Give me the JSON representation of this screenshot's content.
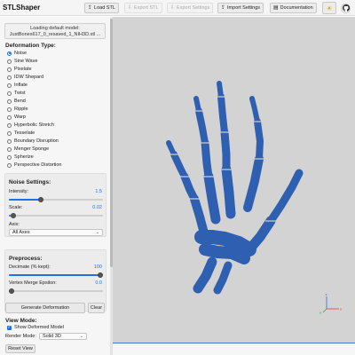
{
  "app": {
    "title": "STLShaper"
  },
  "toolbar": {
    "load_stl": "Load STL",
    "export_stl": "Export STL",
    "export_settings": "Export Settings",
    "import_settings": "Import Settings",
    "documentation": "Documentation",
    "theme_icon": "sun-icon",
    "github_icon": "github-icon"
  },
  "model": {
    "line1": "Loading default model:",
    "line2": "JustBones617_0_resaved_1_NIH3D.stl ..."
  },
  "deformation": {
    "title": "Deformation Type:",
    "selected": "Noise",
    "types": [
      "Noise",
      "Sine Wave",
      "Pixelate",
      "IDW Shepard",
      "Inflate",
      "Twist",
      "Bend",
      "Ripple",
      "Warp",
      "Hyperbolic Stretch",
      "Tesselate",
      "Boundary Disruption",
      "Menger Sponge",
      "Spherize",
      "Perspective Distortion"
    ]
  },
  "noise_settings": {
    "title": "Noise Settings:",
    "intensity_label": "Intensity:",
    "intensity_value": "1.5",
    "intensity_fraction": 0.33,
    "scale_label": "Scale:",
    "scale_value": "0.02",
    "scale_fraction": 0.02,
    "axis_label": "Axis:",
    "axis_value": "All Axes"
  },
  "preprocess": {
    "title": "Preprocess:",
    "decimate_label": "Decimate (% kept):",
    "decimate_value": "100",
    "decimate_fraction": 1.0,
    "merge_label": "Vertex Merge Epsilon:",
    "merge_value": "0.0",
    "merge_fraction": 0.0
  },
  "actions": {
    "generate": "Generate Deformation",
    "clear": "Clear"
  },
  "view_mode": {
    "title": "View Mode:",
    "show_deformed": "Show Deformed Model",
    "show_deformed_checked": true,
    "render_mode_label": "Render Mode:",
    "render_mode_value": "Solid 3D",
    "reset_view": "Reset View"
  },
  "viewport": {
    "background": "#d3d3d3",
    "model_color": "#2f5fb0",
    "axis_labels": {
      "x": "x",
      "y": "y",
      "z": "z"
    }
  }
}
